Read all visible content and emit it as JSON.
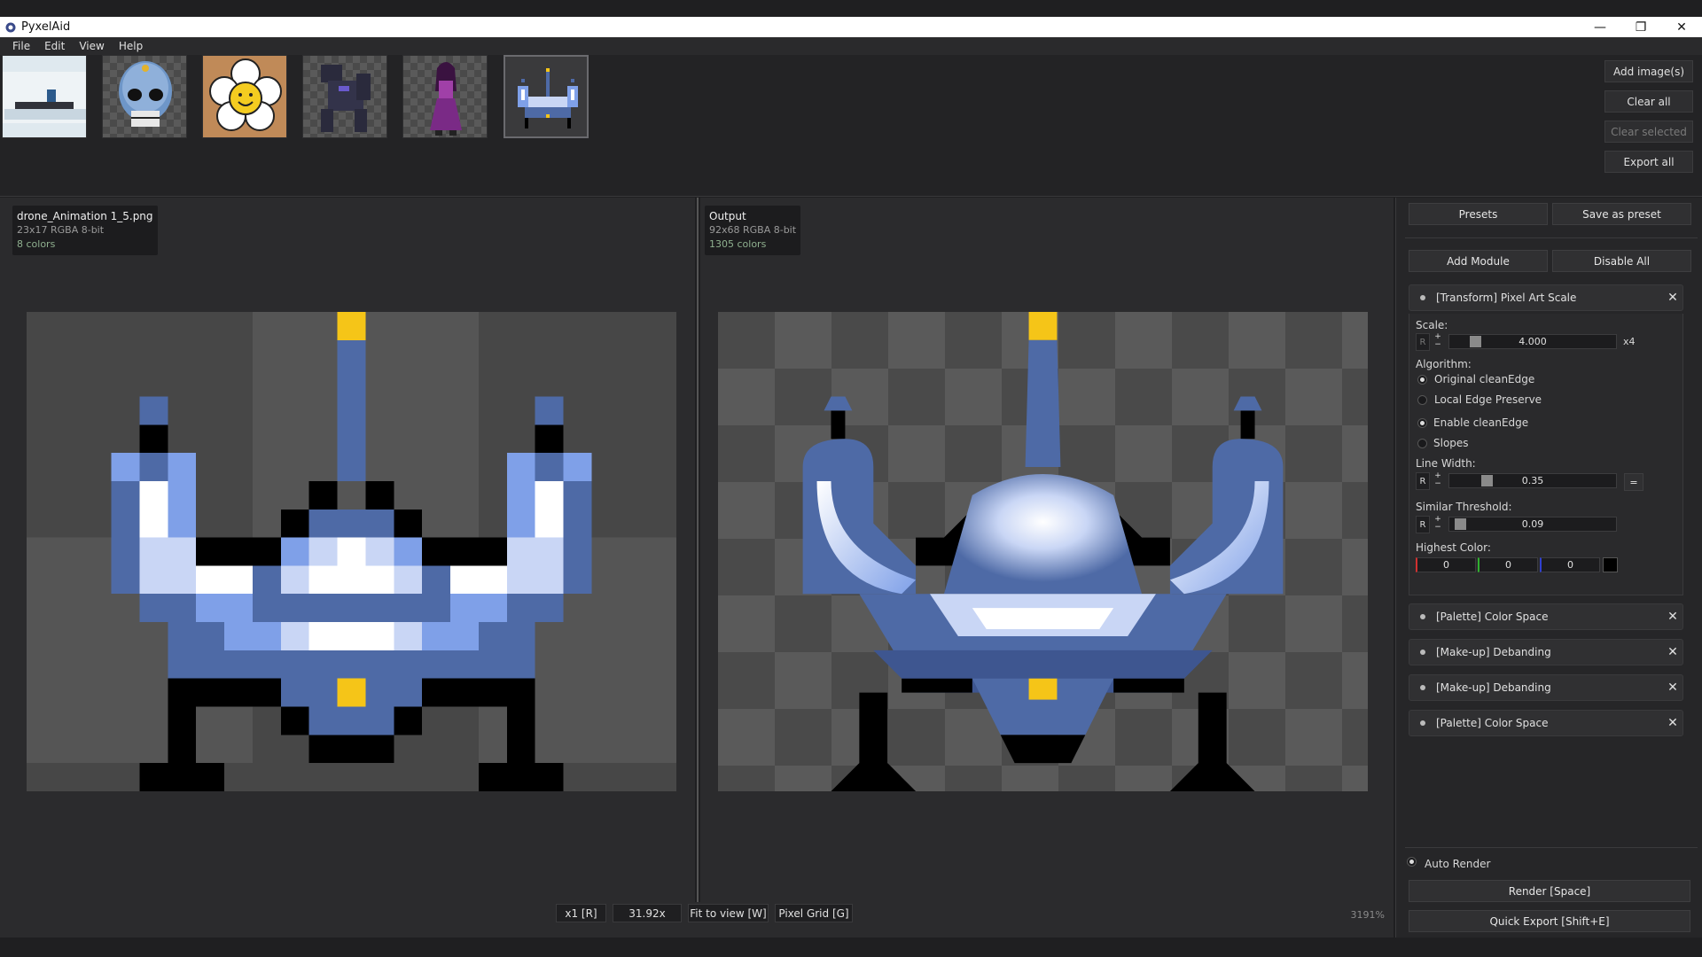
{
  "window": {
    "title": "PyxelAid",
    "controls": {
      "minimize": "—",
      "restore": "❐",
      "close": "✕"
    }
  },
  "menu": [
    "File",
    "Edit",
    "View",
    "Help"
  ],
  "gallery": {
    "thumbs": [
      "snow-scene",
      "blue-skull",
      "smiling-flower",
      "dark-robot",
      "purple-witch",
      "drone"
    ],
    "selected_index": 5,
    "buttons": {
      "add_images": "Add image(s)",
      "clear_all": "Clear all",
      "clear_selected": "Clear selected",
      "export_all": "Export all"
    }
  },
  "input_view": {
    "filename": "drone_Animation 1_5.png",
    "meta": "23x17  RGBA  8-bit",
    "colors": "8 colors"
  },
  "output_view": {
    "filename": "Output",
    "meta": "92x68  RGBA  8-bit",
    "colors": "1305 colors"
  },
  "bottom": {
    "x1": "x1 [R]",
    "zoom_value": "31.92x",
    "fit": "Fit to view [W]",
    "grid": "Pixel Grid [G]",
    "zoom_percent": "3191%"
  },
  "panel": {
    "presets": "Presets",
    "save_preset": "Save as preset",
    "add_module": "Add Module",
    "disable_all": "Disable All",
    "module_title": "[Transform] Pixel Art Scale",
    "scale_label": "Scale:",
    "scale_value": "4.000",
    "scale_fraction": 0.13,
    "scale_suffix": "x4",
    "algorithm_label": "Algorithm:",
    "algo_opt1": "Original cleanEdge",
    "algo_opt2": "Local Edge Preserve",
    "opt_enable": "Enable cleanEdge",
    "opt_slopes": "Slopes",
    "line_width_label": "Line Width:",
    "line_width_value": "0.35",
    "line_width_fraction": 0.2,
    "line_width_reset": "=",
    "threshold_label": "Similar Threshold:",
    "threshold_value": "0.09",
    "threshold_fraction": 0.03,
    "highest_color_label": "Highest Color:",
    "color_r": "0",
    "color_g": "0",
    "color_b": "0",
    "other_modules": [
      "[Palette] Color Space",
      "[Make-up] Debanding",
      "[Make-up] Debanding",
      "[Palette] Color Space"
    ],
    "auto_render": "Auto Render",
    "render": "Render  [Space]",
    "quick_export": "Quick Export  [Shift+E]",
    "r_letter": "R",
    "plus": "+",
    "minus": "−"
  },
  "colors": {
    "drone_blue": "#4e6aa6",
    "drone_light": "#7fa0e8",
    "drone_pale": "#c9d6f5",
    "drone_white": "#ffffff",
    "drone_yellow": "#f5c518",
    "drone_black": "#000000",
    "bg_dark": "#424242",
    "bg_light": "#555555"
  }
}
